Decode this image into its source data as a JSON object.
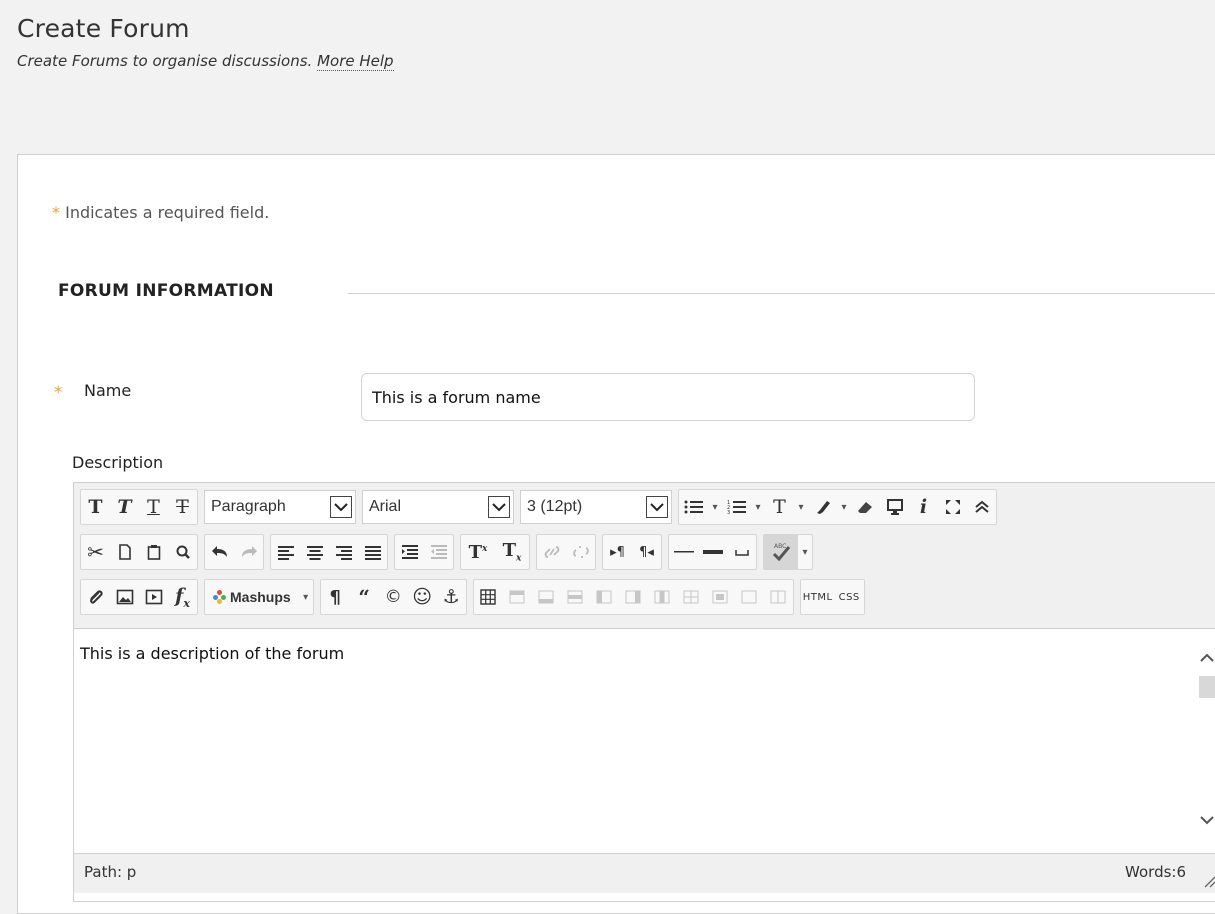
{
  "header": {
    "title": "Create Forum",
    "subtitle": "Create Forums to organise discussions.",
    "help_link": "More Help"
  },
  "form": {
    "required_note": "Indicates a required field.",
    "section_title": "FORUM INFORMATION",
    "name_label": "Name",
    "name_value": "This is a forum name",
    "description_label": "Description"
  },
  "editor": {
    "format_select": "Paragraph",
    "font_select": "Arial",
    "size_select": "3 (12pt)",
    "mashups_label": "Mashups",
    "html_label": "HTML",
    "css_label": "CSS",
    "content": "This is a description of the forum",
    "path_label": "Path: p",
    "word_count": "Words:6"
  },
  "colors": {
    "required_star": "#e8a33a",
    "background": "#f2f2f2",
    "panel": "#ffffff"
  }
}
